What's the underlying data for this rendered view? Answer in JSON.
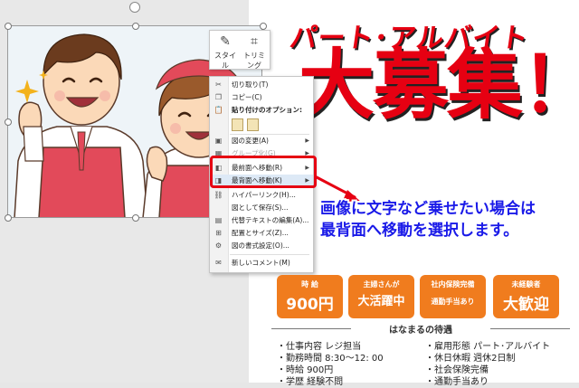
{
  "mini_toolbar": {
    "style_label": "スタイル",
    "trim_label": "トリミング"
  },
  "context_menu": {
    "items": [
      {
        "label": "切り取り(T)",
        "icon": "scissors-icon",
        "enabled": true
      },
      {
        "label": "コピー(C)",
        "icon": "copy-icon",
        "enabled": true
      },
      {
        "label": "貼り付けのオプション:",
        "icon": "paste-icon",
        "enabled": true,
        "bold": true
      },
      {
        "label": "図の変更(A)",
        "icon": "change-picture-icon",
        "enabled": true,
        "submenu": true
      },
      {
        "label": "グループ化(G)",
        "icon": "group-icon",
        "enabled": false,
        "submenu": true
      },
      {
        "label": "最前面へ移動(R)",
        "icon": "bring-to-front-icon",
        "enabled": true,
        "submenu": true
      },
      {
        "label": "最背面へ移動(K)",
        "icon": "send-to-back-icon",
        "enabled": true,
        "submenu": true
      },
      {
        "label": "ハイパーリンク(H)...",
        "icon": "hyperlink-icon",
        "enabled": true
      },
      {
        "label": "図として保存(S)...",
        "icon": "",
        "enabled": true
      },
      {
        "label": "代替テキストの編集(A)...",
        "icon": "alt-text-icon",
        "enabled": true
      },
      {
        "label": "配置とサイズ(Z)...",
        "icon": "size-position-icon",
        "enabled": true
      },
      {
        "label": "図の書式設定(O)...",
        "icon": "format-picture-icon",
        "enabled": true
      },
      {
        "label": "新しいコメント(M)",
        "icon": "comment-icon",
        "enabled": true
      }
    ]
  },
  "flyer": {
    "title_small": "パート･アルバイト",
    "title_big": "大募集！",
    "badges": [
      {
        "top": "時 給",
        "bottom": "900円",
        "color": "#f07c1e"
      },
      {
        "top": "主婦さんが",
        "bottom": "大活躍中",
        "color": "#f07c1e"
      },
      {
        "top": "社内保険完備",
        "bottom": "通勤手当あり",
        "color": "#f07c1e"
      },
      {
        "top": "未経験者",
        "bottom": "大歓迎",
        "color": "#f07c1e"
      }
    ],
    "section_title": "はなまるの待遇",
    "left_list": [
      "・仕事内容 レジ担当",
      "・勤務時間 8:30～12: 00",
      "・時給 900円",
      "・学歴 経験不問"
    ],
    "right_list": [
      "・雇用形態 パート･アルバイト",
      "・休日休暇 週休2日制",
      "・社会保険完備",
      "・通勤手当あり"
    ]
  },
  "annotation": {
    "line1": "画像に文字など乗せたい場合は",
    "line2": "最背面へ移動を選択します。",
    "color": "#1a1ae8",
    "highlight_color": "#e60012"
  }
}
